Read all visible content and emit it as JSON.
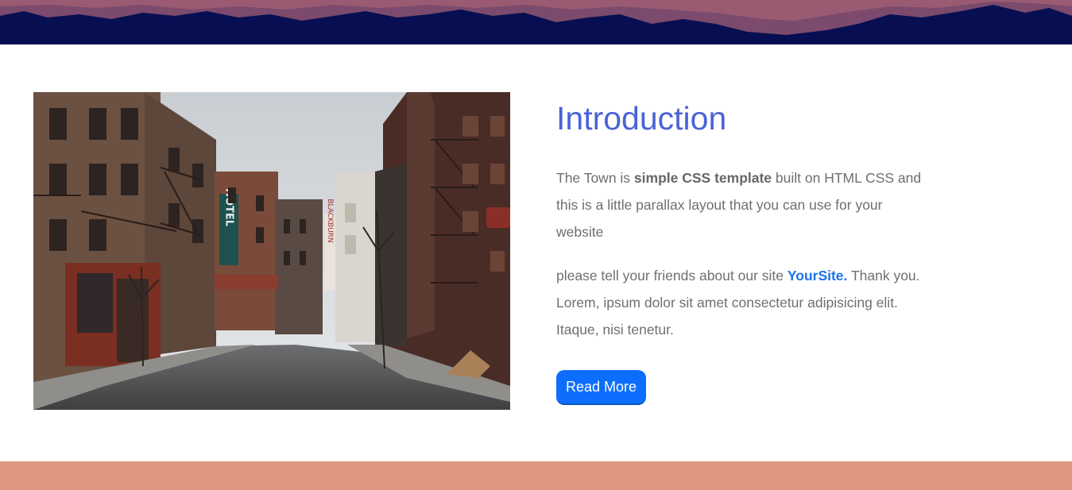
{
  "colors": {
    "top_band": "#070f52",
    "title": "#4a63d6",
    "body_text": "#6f6f6f",
    "link": "#1b73e8",
    "button": "#0d6efd",
    "bottom_band": "#df9782"
  },
  "image": {
    "sign_hotel": "HOTEL",
    "sign_blackburn": "BLACKBURN"
  },
  "intro": {
    "title": "Introduction",
    "para1_prefix": "The Town is ",
    "para1_strong": "simple CSS template",
    "para1_suffix": " built on HTML CSS and this is a little parallax layout that you can use for your website",
    "para2_prefix": "please tell your friends about our site ",
    "para2_link": "YourSite.",
    "para2_suffix": " Thank you. Lorem, ipsum dolor sit amet consectetur adipisicing elit. Itaque, nisi tenetur.",
    "button_label": "Read More"
  }
}
